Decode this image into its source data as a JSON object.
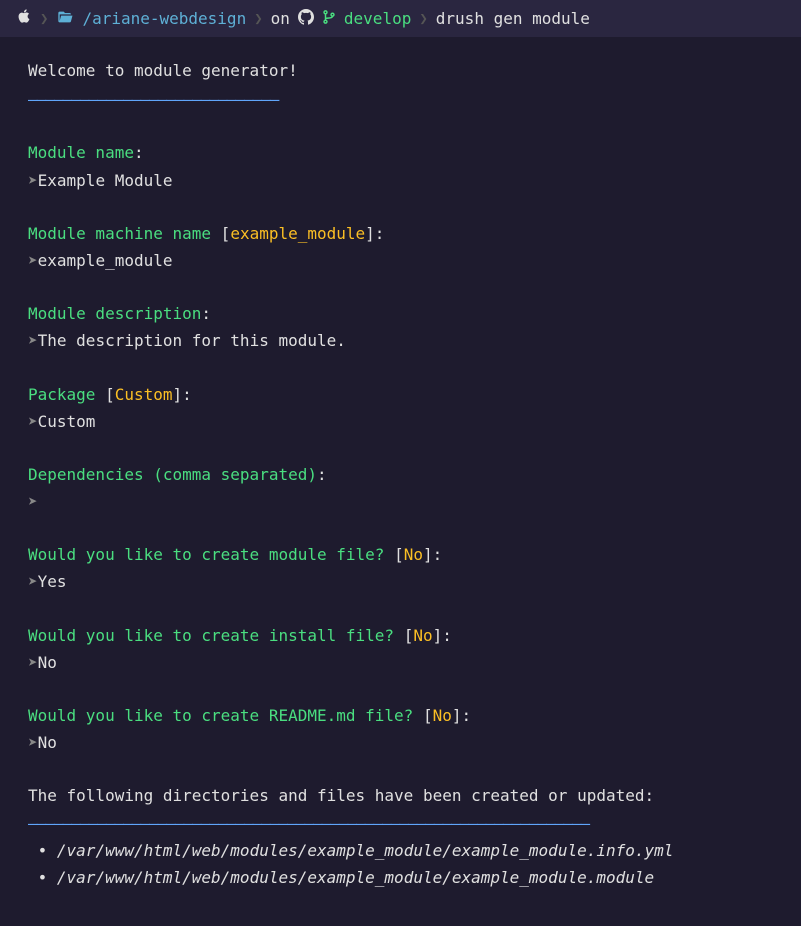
{
  "header": {
    "path": "/ariane-webdesign",
    "on": "on",
    "branch": "develop",
    "command": "drush gen module"
  },
  "welcome": "Welcome to module generator!",
  "underline1": "–––––––––––––––––––––––––––––",
  "prompts": [
    {
      "label": "Module name",
      "default": "",
      "answer": "Example Module"
    },
    {
      "label": "Module machine name",
      "default": "example_module",
      "answer": "example_module"
    },
    {
      "label": "Module description",
      "default": "",
      "answer": "The description for this module."
    },
    {
      "label": "Package",
      "default": "Custom",
      "answer": "Custom"
    },
    {
      "label": "Dependencies (comma separated)",
      "default": "",
      "answer": ""
    },
    {
      "label": "Would you like to create module file?",
      "default": "No",
      "answer": "Yes"
    },
    {
      "label": "Would you like to create install file?",
      "default": "No",
      "answer": "No"
    },
    {
      "label": "Would you like to create README.md file?",
      "default": "No",
      "answer": "No"
    }
  ],
  "result_header": "The following directories and files have been created or updated:",
  "underline2": "–––––––––––––––––––––––––––––––––––––––––––––––––––––––––––––––––",
  "files": [
    "/var/www/html/web/modules/example_module/example_module.info.yml",
    "/var/www/html/web/modules/example_module/example_module.module"
  ]
}
